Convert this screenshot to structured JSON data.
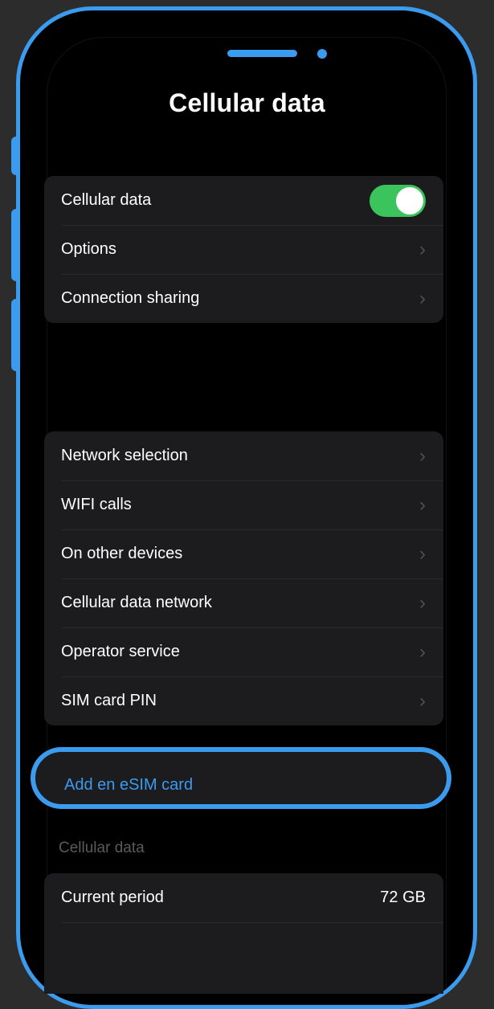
{
  "screen": {
    "title": "Cellular data"
  },
  "group1": {
    "items": [
      {
        "label": "Cellular data",
        "control": "toggle",
        "toggle_on": true
      },
      {
        "label": "Options",
        "control": "chevron"
      },
      {
        "label": "Connection sharing",
        "control": "chevron"
      }
    ]
  },
  "group2": {
    "items": [
      {
        "label": "Network selection"
      },
      {
        "label": "WIFI calls"
      },
      {
        "label": "On other devices"
      },
      {
        "label": "Cellular data network"
      },
      {
        "label": "Operator service"
      },
      {
        "label": "SIM card PIN"
      }
    ]
  },
  "esim": {
    "label": "Add en eSIM card"
  },
  "usage": {
    "section_header": "Cellular data",
    "current_period_label": "Current period",
    "current_period_value": "72 GB"
  },
  "icons": {
    "chevron": "›"
  },
  "colors": {
    "accent": "#3a9bef",
    "toggle_on": "#3cc45c",
    "background": "#2d2c2c",
    "cell_background": "#1c1c1e"
  }
}
